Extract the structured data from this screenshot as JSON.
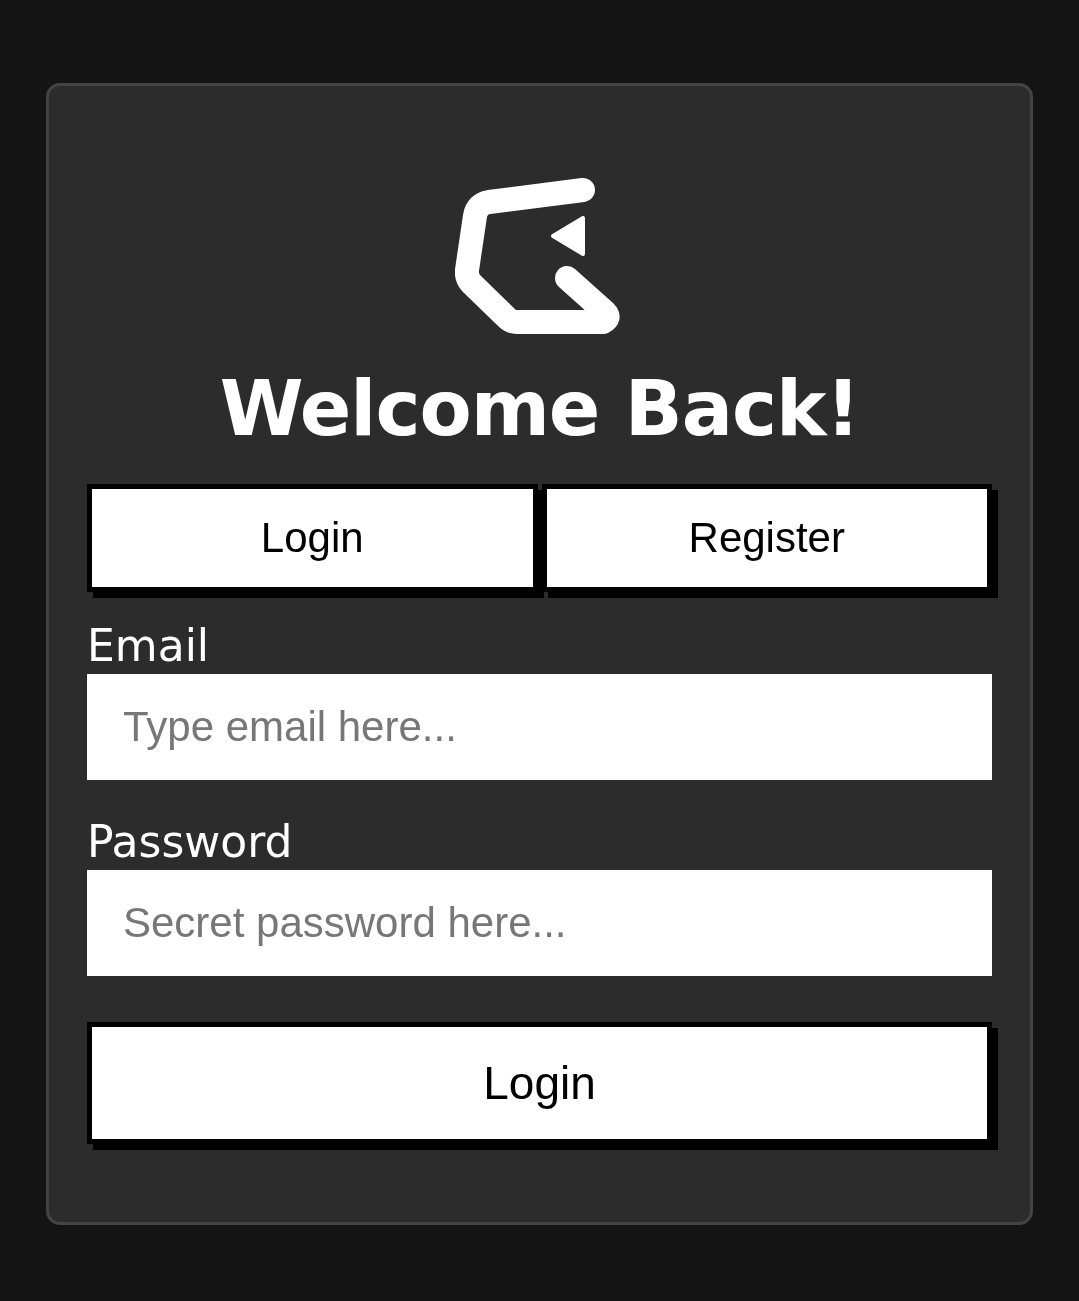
{
  "title": "Welcome Back!",
  "tabs": [
    {
      "label": "Login"
    },
    {
      "label": "Register"
    }
  ],
  "fields": [
    {
      "label": "Email",
      "placeholder": "Type email here..."
    },
    {
      "label": "Password",
      "placeholder": "Secret password here..."
    }
  ],
  "submit": "Login"
}
